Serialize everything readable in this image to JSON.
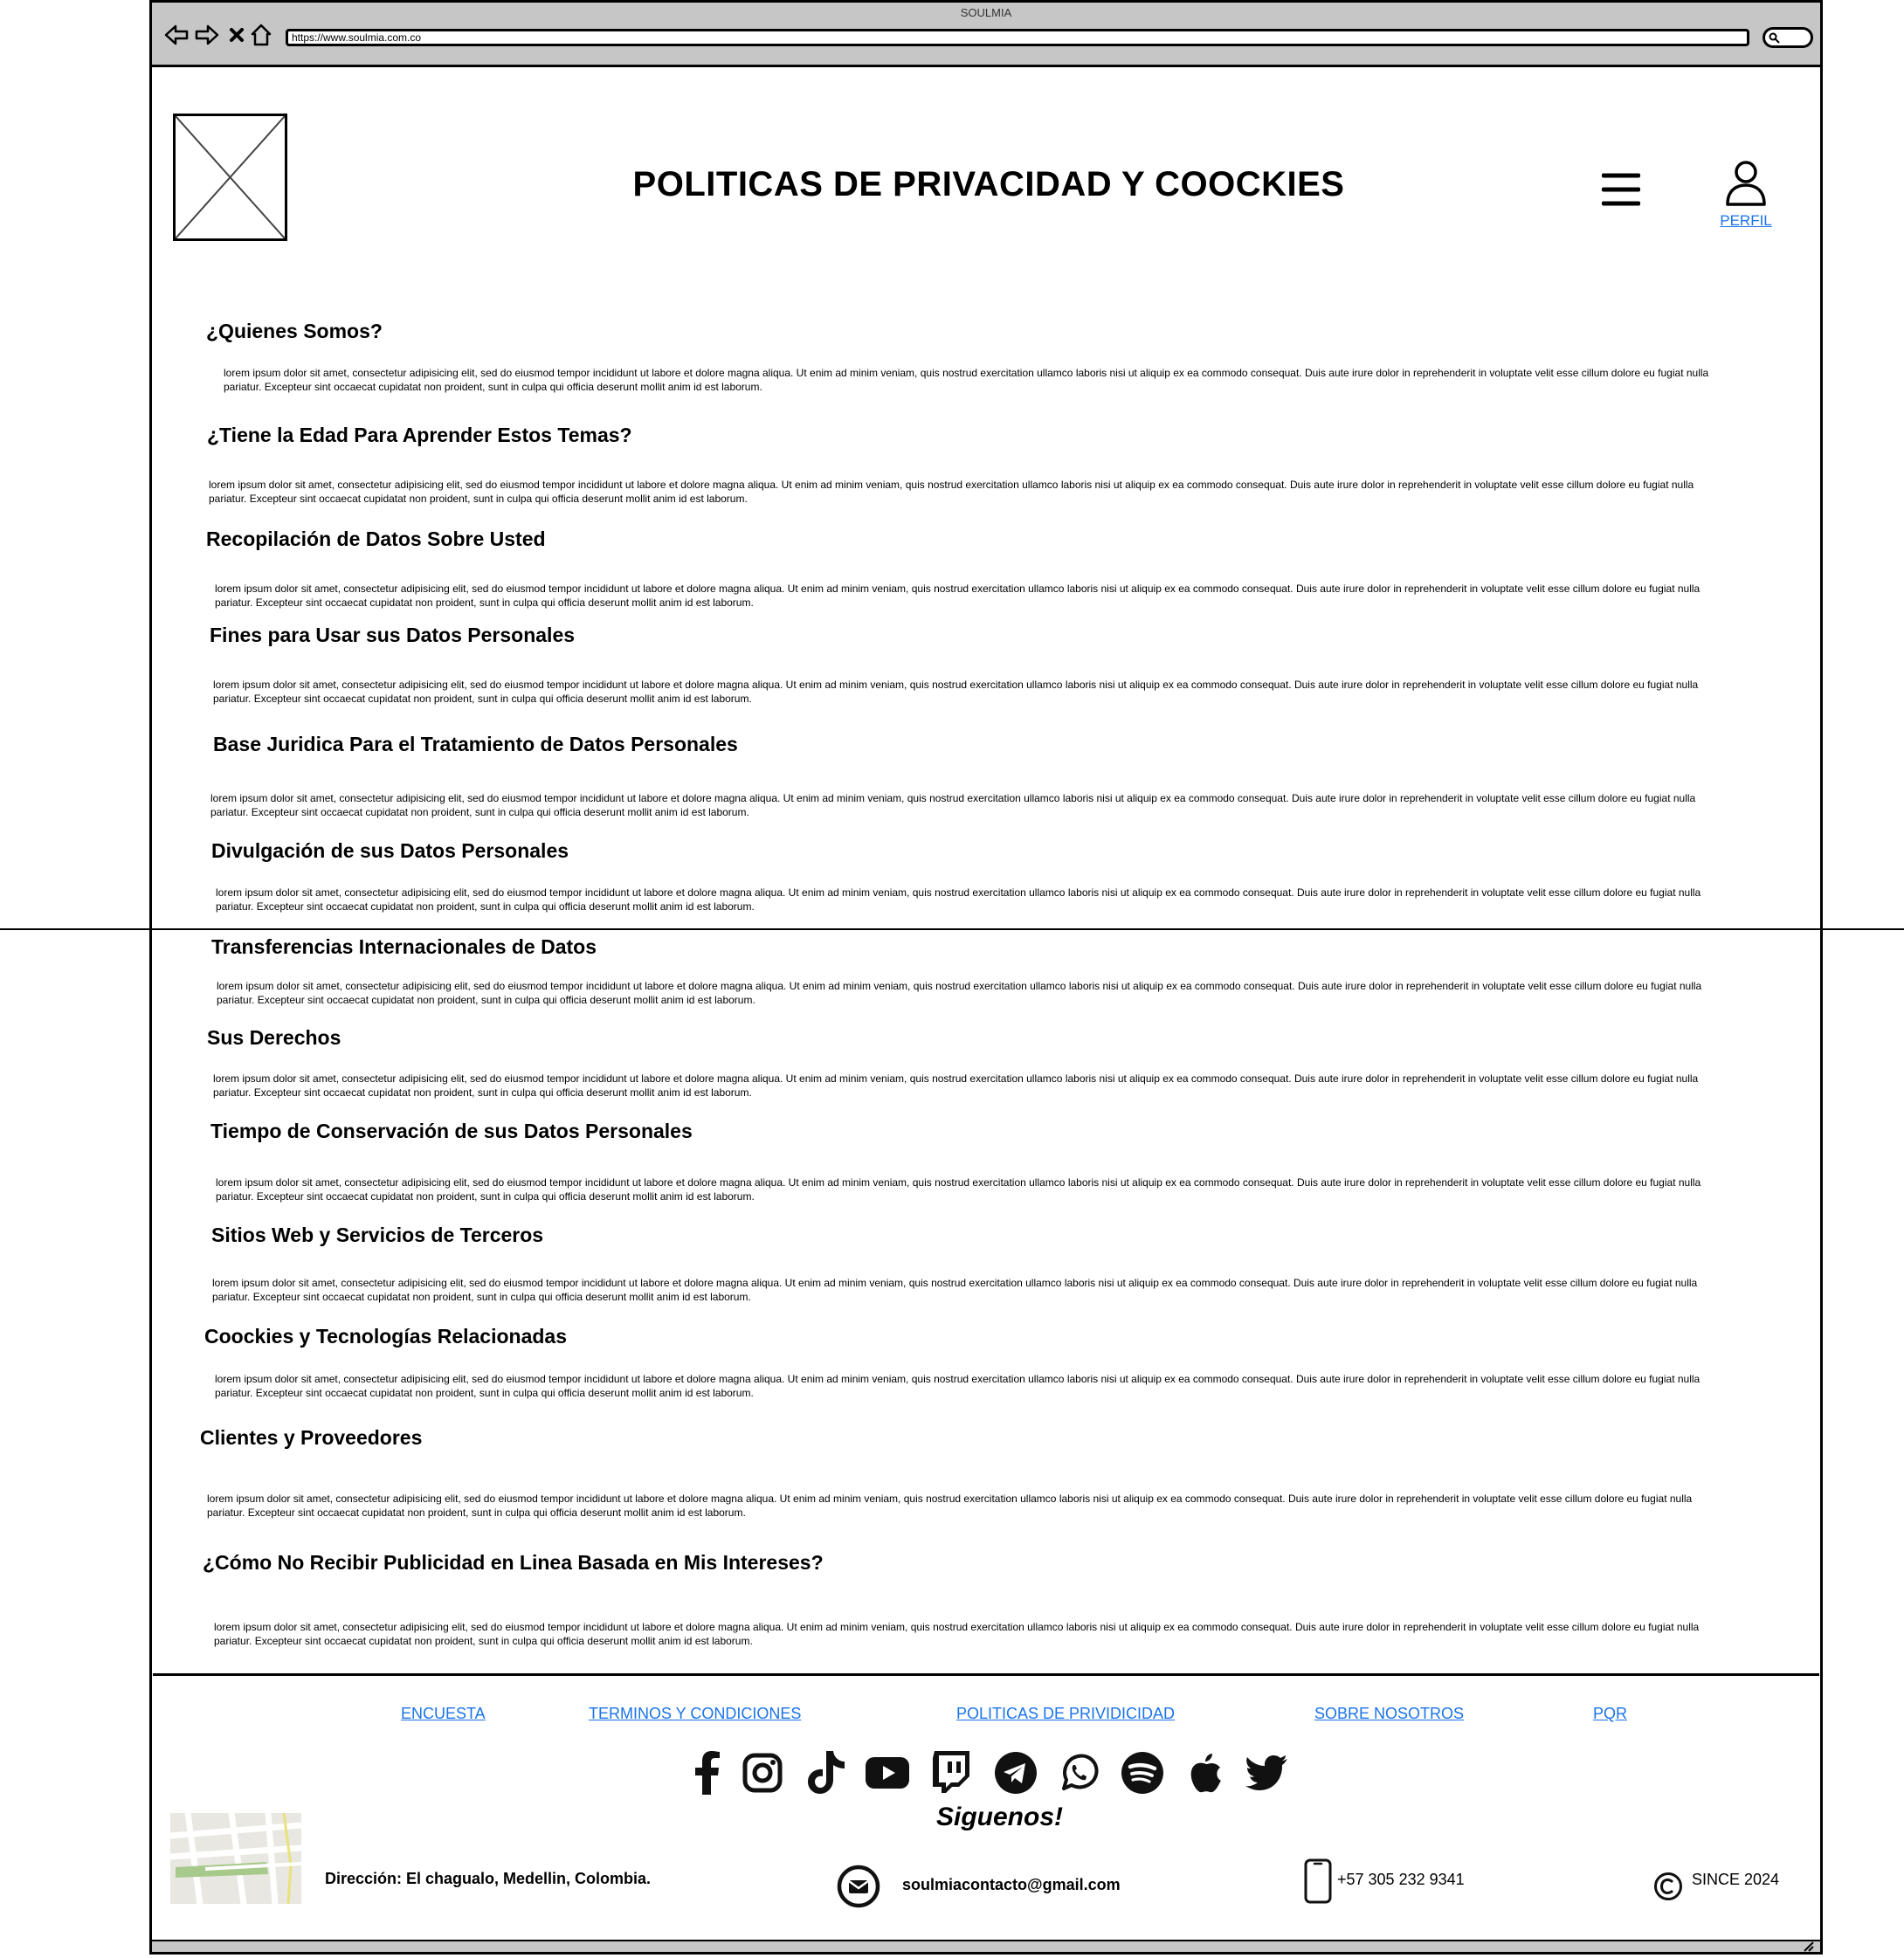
{
  "browser": {
    "window_title": "SOULMIA",
    "url": "https://www.soulmia.com.co",
    "back_icon": "back-arrow-icon",
    "forward_icon": "forward-arrow-icon",
    "stop_icon": "close-icon",
    "home_icon": "home-icon"
  },
  "header": {
    "title": "POLITICAS DE PRIVACIDAD Y COOCKIES",
    "profile_label": "PERFIL"
  },
  "sections": [
    {
      "heading": "¿Quienes Somos?",
      "body": "lorem ipsum dolor sit amet, consectetur adipisicing elit, sed do eiusmod tempor incididunt ut labore et dolore magna aliqua. Ut enim ad minim veniam, quis nostrud exercitation ullamco laboris nisi ut aliquip ex ea commodo consequat. Duis aute irure dolor in reprehenderit in voluptate velit esse cillum dolore eu fugiat nulla pariatur. Excepteur sint occaecat cupidatat non proident, sunt in culpa qui officia deserunt mollit anim id est laborum."
    },
    {
      "heading": "¿Tiene la Edad Para Aprender Estos Temas?",
      "body": "lorem ipsum dolor sit amet, consectetur adipisicing elit, sed do eiusmod tempor incididunt ut labore et dolore magna aliqua. Ut enim ad minim veniam, quis nostrud exercitation ullamco laboris nisi ut aliquip ex ea commodo consequat. Duis aute irure dolor in reprehenderit in voluptate velit esse cillum dolore eu fugiat nulla pariatur. Excepteur sint occaecat cupidatat non proident, sunt in culpa qui officia deserunt mollit anim id est laborum."
    },
    {
      "heading": "Recopilación de Datos Sobre Usted",
      "body": "lorem ipsum dolor sit amet, consectetur adipisicing elit, sed do eiusmod tempor incididunt ut labore et dolore magna aliqua. Ut enim ad minim veniam, quis nostrud exercitation ullamco laboris nisi ut aliquip ex ea commodo consequat. Duis aute irure dolor in reprehenderit in voluptate velit esse cillum dolore eu fugiat nulla pariatur. Excepteur sint occaecat cupidatat non proident, sunt in culpa qui officia deserunt mollit anim id est laborum."
    },
    {
      "heading": "Fines para Usar sus Datos Personales",
      "body": "lorem ipsum dolor sit amet, consectetur adipisicing elit, sed do eiusmod tempor incididunt ut labore et dolore magna aliqua. Ut enim ad minim veniam, quis nostrud exercitation ullamco laboris nisi ut aliquip ex ea commodo consequat. Duis aute irure dolor in reprehenderit in voluptate velit esse cillum dolore eu fugiat nulla pariatur. Excepteur sint occaecat cupidatat non proident, sunt in culpa qui officia deserunt mollit anim id est laborum."
    },
    {
      "heading": "Base Juridica Para el Tratamiento de Datos Personales",
      "body": "lorem ipsum dolor sit amet, consectetur adipisicing elit, sed do eiusmod tempor incididunt ut labore et dolore magna aliqua. Ut enim ad minim veniam, quis nostrud exercitation ullamco laboris nisi ut aliquip ex ea commodo consequat. Duis aute irure dolor in reprehenderit in voluptate velit esse cillum dolore eu fugiat nulla pariatur. Excepteur sint occaecat cupidatat non proident, sunt in culpa qui officia deserunt mollit anim id est laborum."
    },
    {
      "heading": "Divulgación de sus Datos Personales",
      "body": "lorem ipsum dolor sit amet, consectetur adipisicing elit, sed do eiusmod tempor incididunt ut labore et dolore magna aliqua. Ut enim ad minim veniam, quis nostrud exercitation ullamco laboris nisi ut aliquip ex ea commodo consequat. Duis aute irure dolor in reprehenderit in voluptate velit esse cillum dolore eu fugiat nulla pariatur. Excepteur sint occaecat cupidatat non proident, sunt in culpa qui officia deserunt mollit anim id est laborum."
    },
    {
      "heading": "Transferencias Internacionales de Datos",
      "body": "lorem ipsum dolor sit amet, consectetur adipisicing elit, sed do eiusmod tempor incididunt ut labore et dolore magna aliqua. Ut enim ad minim veniam, quis nostrud exercitation ullamco laboris nisi ut aliquip ex ea commodo consequat. Duis aute irure dolor in reprehenderit in voluptate velit esse cillum dolore eu fugiat nulla pariatur. Excepteur sint occaecat cupidatat non proident, sunt in culpa qui officia deserunt mollit anim id est laborum."
    },
    {
      "heading": "Sus Derechos",
      "body": "lorem ipsum dolor sit amet, consectetur adipisicing elit, sed do eiusmod tempor incididunt ut labore et dolore magna aliqua. Ut enim ad minim veniam, quis nostrud exercitation ullamco laboris nisi ut aliquip ex ea commodo consequat. Duis aute irure dolor in reprehenderit in voluptate velit esse cillum dolore eu fugiat nulla pariatur. Excepteur sint occaecat cupidatat non proident, sunt in culpa qui officia deserunt mollit anim id est laborum."
    },
    {
      "heading": "Tiempo de Conservación de sus Datos Personales",
      "body": "lorem ipsum dolor sit amet, consectetur adipisicing elit, sed do eiusmod tempor incididunt ut labore et dolore magna aliqua. Ut enim ad minim veniam, quis nostrud exercitation ullamco laboris nisi ut aliquip ex ea commodo consequat. Duis aute irure dolor in reprehenderit in voluptate velit esse cillum dolore eu fugiat nulla pariatur. Excepteur sint occaecat cupidatat non proident, sunt in culpa qui officia deserunt mollit anim id est laborum."
    },
    {
      "heading": "Sitios Web y Servicios de Terceros",
      "body": "lorem ipsum dolor sit amet, consectetur adipisicing elit, sed do eiusmod tempor incididunt ut labore et dolore magna aliqua. Ut enim ad minim veniam, quis nostrud exercitation ullamco laboris nisi ut aliquip ex ea commodo consequat. Duis aute irure dolor in reprehenderit in voluptate velit esse cillum dolore eu fugiat nulla pariatur. Excepteur sint occaecat cupidatat non proident, sunt in culpa qui officia deserunt mollit anim id est laborum."
    },
    {
      "heading": "Coockies y Tecnologías Relacionadas",
      "body": "lorem ipsum dolor sit amet, consectetur adipisicing elit, sed do eiusmod tempor incididunt ut labore et dolore magna aliqua. Ut enim ad minim veniam, quis nostrud exercitation ullamco laboris nisi ut aliquip ex ea commodo consequat. Duis aute irure dolor in reprehenderit in voluptate velit esse cillum dolore eu fugiat nulla pariatur. Excepteur sint occaecat cupidatat non proident, sunt in culpa qui officia deserunt mollit anim id est laborum."
    },
    {
      "heading": "Clientes y Proveedores",
      "body": "lorem ipsum dolor sit amet, consectetur adipisicing elit, sed do eiusmod tempor incididunt ut labore et dolore magna aliqua. Ut enim ad minim veniam, quis nostrud exercitation ullamco laboris nisi ut aliquip ex ea commodo consequat. Duis aute irure dolor in reprehenderit in voluptate velit esse cillum dolore eu fugiat nulla pariatur. Excepteur sint occaecat cupidatat non proident, sunt in culpa qui officia deserunt mollit anim id est laborum."
    },
    {
      "heading": "¿Cómo No Recibir Publicidad en Linea Basada en Mis Intereses?",
      "body": "lorem ipsum dolor sit amet, consectetur adipisicing elit, sed do eiusmod tempor incididunt ut labore et dolore magna aliqua. Ut enim ad minim veniam, quis nostrud exercitation ullamco laboris nisi ut aliquip ex ea commodo consequat. Duis aute irure dolor in reprehenderit in voluptate velit esse cillum dolore eu fugiat nulla pariatur. Excepteur sint occaecat cupidatat non proident, sunt in culpa qui officia deserunt mollit anim id est laborum."
    }
  ],
  "footer": {
    "links": [
      "ENCUESTA",
      "TERMINOS Y CONDICIONES",
      "POLITICAS DE PRIVIDICIDAD",
      "SOBRE NOSOTROS",
      "PQR"
    ],
    "social_icons": [
      "facebook-icon",
      "instagram-icon",
      "tiktok-icon",
      "youtube-icon",
      "twitch-icon",
      "telegram-icon",
      "whatsapp-icon",
      "spotify-icon",
      "apple-icon",
      "twitter-icon"
    ],
    "follow_text": "Siguenos!",
    "address": "Dirección: El chagualo, Medellin, Colombia.",
    "email": "soulmiacontacto@gmail.com",
    "phone": "+57 305 232 9341",
    "since": "SINCE 2024"
  },
  "colors": {
    "link": "#1a73e8",
    "titlebar": "#c6c6c6",
    "border": "#000000"
  }
}
